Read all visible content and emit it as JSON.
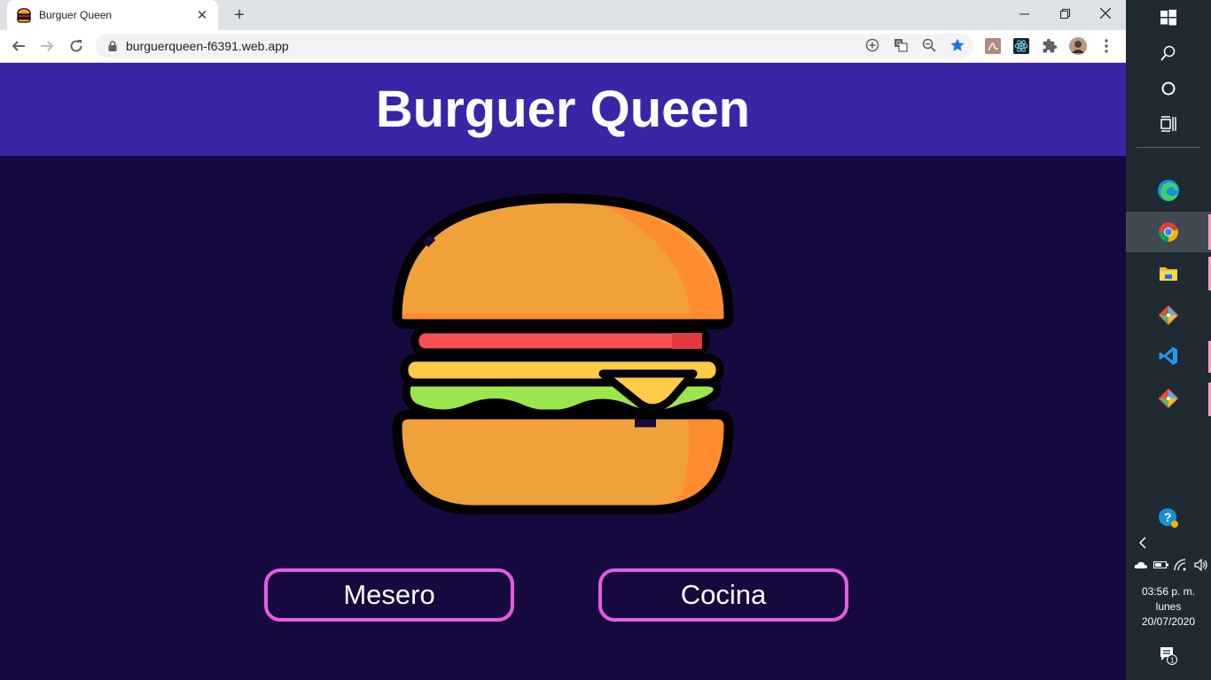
{
  "browser": {
    "tab": {
      "title": "Burguer Queen"
    },
    "address_bar": {
      "url": "burguerqueen-f6391.web.app"
    }
  },
  "page": {
    "header": {
      "title": "Burguer Queen"
    },
    "buttons": {
      "mesero": "Mesero",
      "cocina": "Cocina"
    }
  },
  "colors": {
    "header_bg": "#3b24a6",
    "page_bg": "#16093f",
    "button_border": "#e35de0"
  },
  "taskbar": {
    "apps": [
      "start-icon",
      "search-icon",
      "cortana-icon",
      "task-view-icon",
      "edge-icon",
      "chrome-icon",
      "file-explorer-icon",
      "git-icon",
      "vscode-icon",
      "git-icon",
      "help-icon"
    ],
    "clock": {
      "time": "03:56 p. m.",
      "day": "lunes",
      "date": "20/07/2020"
    },
    "notifications_count": "1"
  }
}
